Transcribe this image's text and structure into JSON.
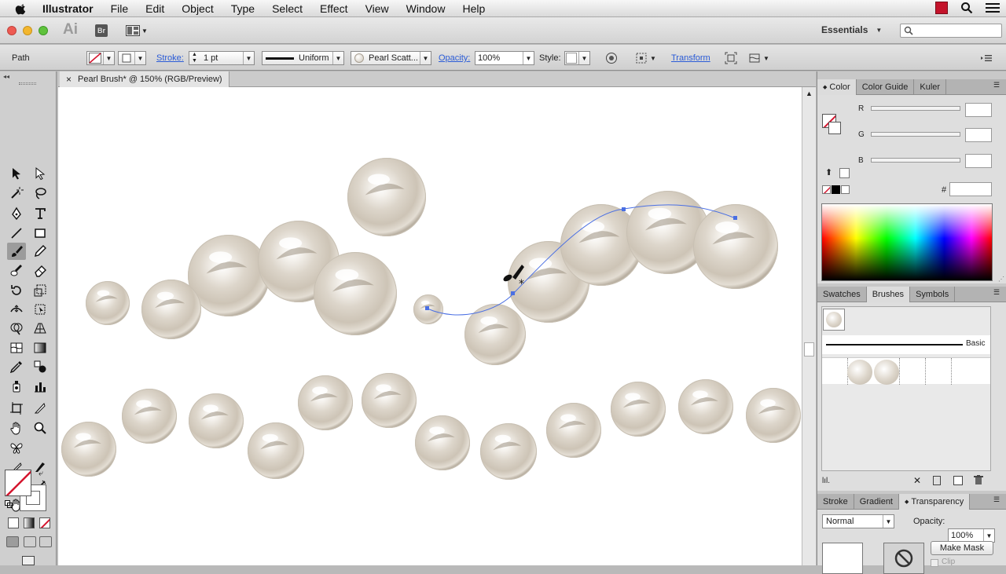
{
  "menubar": {
    "app": "Illustrator",
    "items": [
      "File",
      "Edit",
      "Object",
      "Type",
      "Select",
      "Effect",
      "View",
      "Window",
      "Help"
    ]
  },
  "appbar": {
    "logo": "Ai",
    "bridge": "Br",
    "workspace": "Essentials",
    "search_placeholder": ""
  },
  "controlbar": {
    "selection": "Path",
    "stroke_label": "Stroke:",
    "stroke_weight": "1 pt",
    "profile": "Uniform",
    "brush": "Pearl Scatt...",
    "opacity_label": "Opacity:",
    "opacity": "100%",
    "style_label": "Style:",
    "transform": "Transform"
  },
  "document": {
    "tab_title": "Pearl Brush* @ 150% (RGB/Preview)",
    "close": "×"
  },
  "color_panel": {
    "tabs": [
      "Color",
      "Color Guide",
      "Kuler"
    ],
    "channels": [
      "R",
      "G",
      "B"
    ],
    "hex_label": "#",
    "hex_value": ""
  },
  "brushes_panel": {
    "tabs": [
      "Swatches",
      "Brushes",
      "Symbols"
    ],
    "basic_label": "Basic"
  },
  "transparency_panel": {
    "tabs": [
      "Stroke",
      "Gradient",
      "Transparency"
    ],
    "blend_mode": "Normal",
    "opacity_label": "Opacity:",
    "opacity": "100%",
    "make_mask": "Make Mask",
    "clip": "Clip"
  },
  "colors": {
    "accent_link": "#2a5bd7",
    "path_blue": "#4a6fe3",
    "none_red": "#d4152e",
    "pearl": "#e8e2d8"
  }
}
